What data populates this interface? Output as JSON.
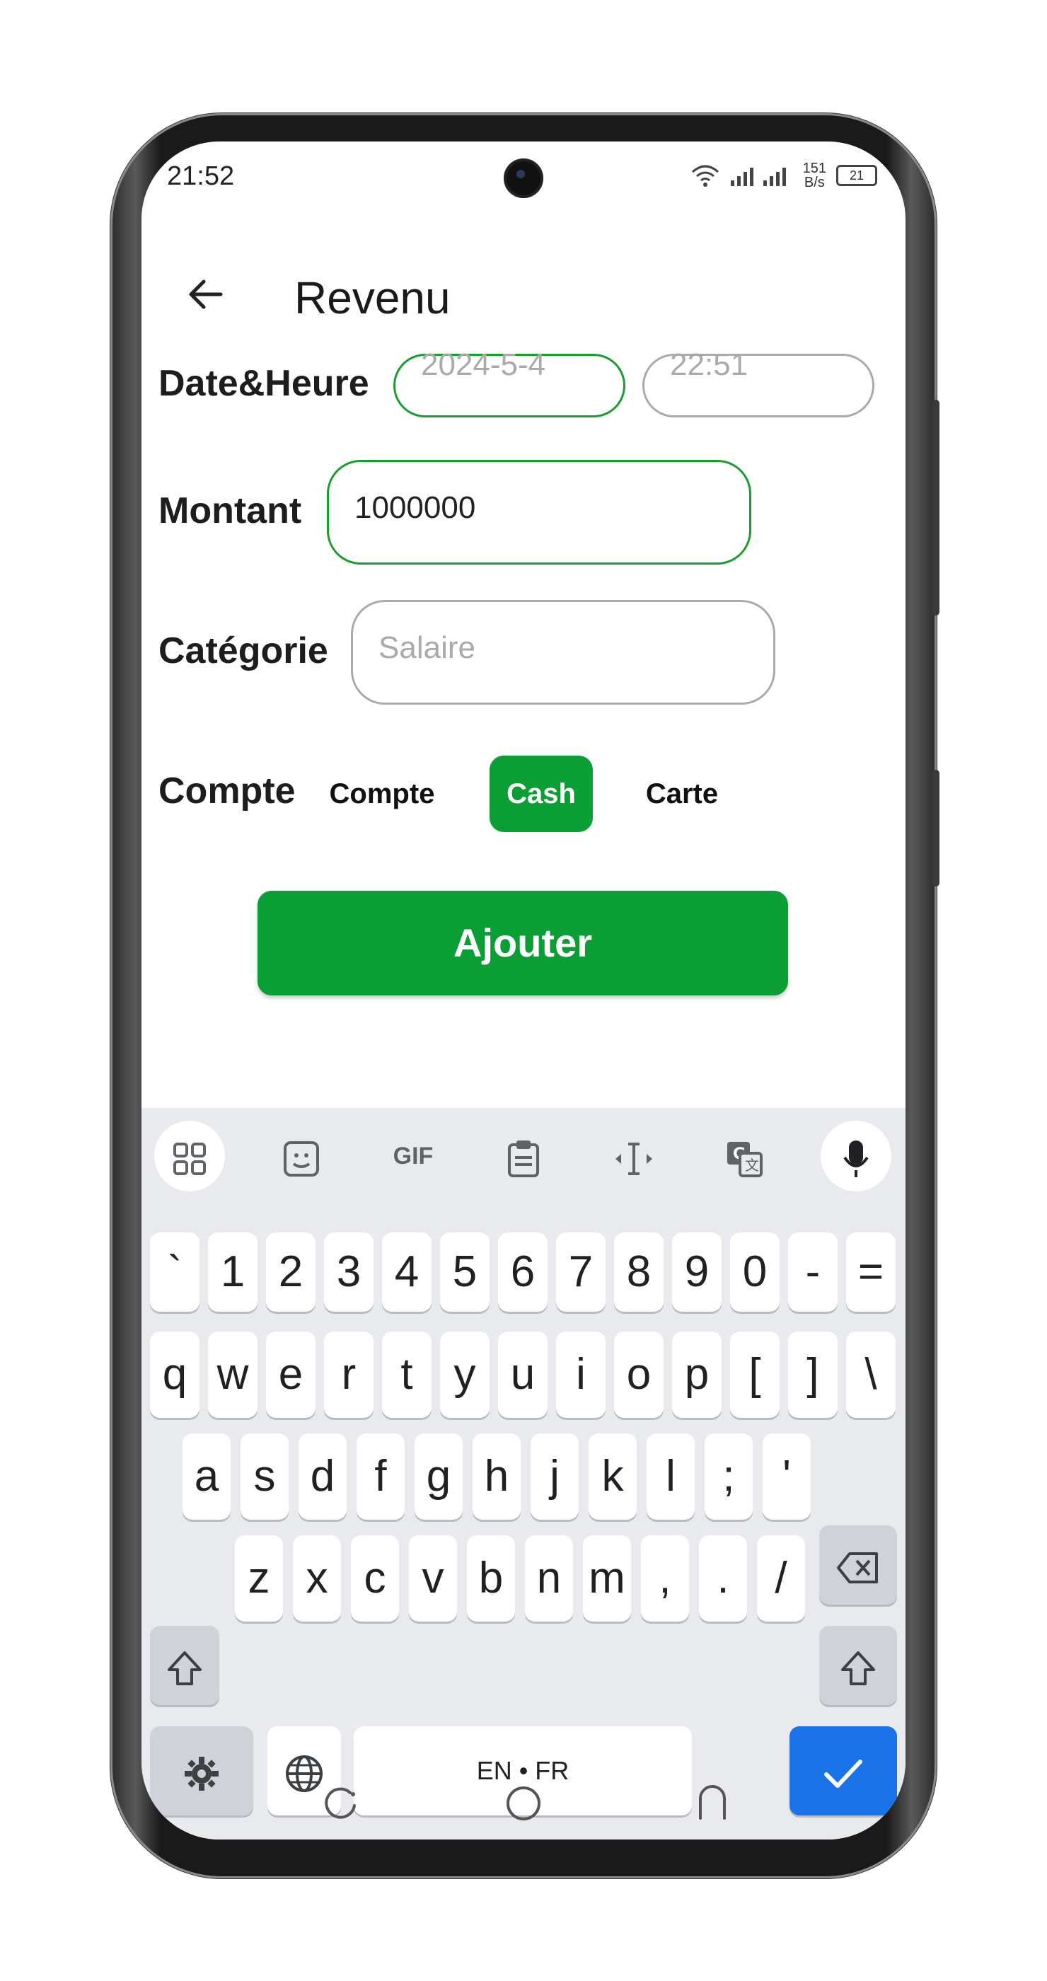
{
  "status_bar": {
    "time": "21:52",
    "net_speed_top": "151",
    "net_speed_bottom": "B/s",
    "battery": "21"
  },
  "header": {
    "title": "Revenu"
  },
  "form": {
    "datetime_label": "Date&Heure",
    "date_placeholder": "2024-5-4",
    "time_placeholder": "22:51",
    "amount_label": "Montant",
    "amount_value": "1000000",
    "category_label": "Catégorie",
    "category_placeholder": "Salaire",
    "account_label": "Compte",
    "account_options": [
      "Compte",
      "Cash",
      "Carte"
    ],
    "account_selected": "Cash",
    "submit_label": "Ajouter"
  },
  "keyboard": {
    "row_numbers": [
      "`",
      "1",
      "2",
      "3",
      "4",
      "5",
      "6",
      "7",
      "8",
      "9",
      "0",
      "-",
      "="
    ],
    "row_q": [
      "q",
      "w",
      "e",
      "r",
      "t",
      "y",
      "u",
      "i",
      "o",
      "p",
      "[",
      "]",
      "\\"
    ],
    "row_a": [
      "a",
      "s",
      "d",
      "f",
      "g",
      "h",
      "j",
      "k",
      "l",
      ";",
      "'"
    ],
    "row_z": [
      "z",
      "x",
      "c",
      "v",
      "b",
      "n",
      "m",
      ",",
      ".",
      "/"
    ],
    "space_label": "EN • FR",
    "gif_label": "GIF"
  },
  "colors": {
    "accent_green": "#0a9e34",
    "focus_green": "#1a9d2f",
    "enter_blue": "#1a73e8"
  }
}
